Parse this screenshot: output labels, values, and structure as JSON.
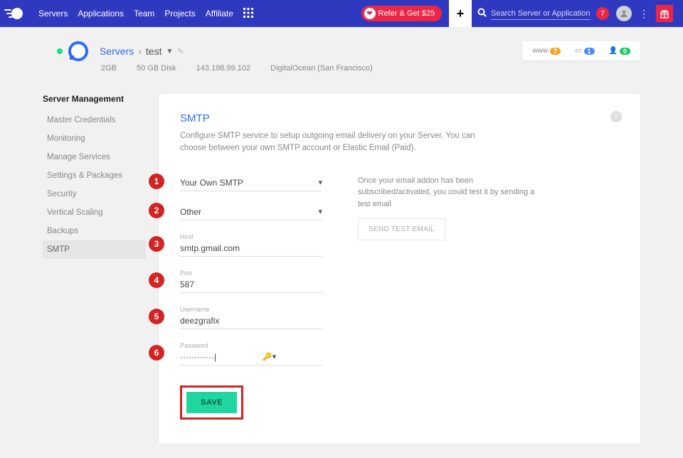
{
  "top": {
    "nav": [
      "Servers",
      "Applications",
      "Team",
      "Projects",
      "Affiliate"
    ],
    "refer": "Refer & Get $25",
    "search_ph": "Search Server or Application",
    "notif": "7"
  },
  "server": {
    "crumb_root": "Servers",
    "name": "test",
    "ram": "2GB",
    "disk": "50 GB Disk",
    "ip": "143.198.99.102",
    "provider": "DigitalOcean (San Francisco)",
    "www_label": "www",
    "www_count": "7",
    "apps_count": "1",
    "team_count": "0"
  },
  "side": {
    "heading": "Server Management",
    "items": [
      "Master Credentials",
      "Monitoring",
      "Manage Services",
      "Settings & Packages",
      "Security",
      "Vertical Scaling",
      "Backups",
      "SMTP"
    ],
    "active": "SMTP"
  },
  "panel": {
    "title": "SMTP",
    "desc": "Configure SMTP service to setup outgoing email delivery on your Server. You can choose between your own SMTP account or Elastic Email (Paid).",
    "right_note": "Once your email addon has been subscribed/activated, you could test it by sending a test email",
    "send_btn": "SEND TEST EMAIL",
    "save_btn": "SAVE",
    "fields": {
      "f1": {
        "value": "Your Own SMTP"
      },
      "f2": {
        "value": "Other"
      },
      "f3": {
        "label": "Host",
        "value": "smtp.gmail.com"
      },
      "f4": {
        "label": "Port",
        "value": "587"
      },
      "f5": {
        "label": "Username",
        "value": "deezgrafix"
      },
      "f6": {
        "label": "Password",
        "value": "············|"
      }
    },
    "steps": {
      "s1": "1",
      "s2": "2",
      "s3": "3",
      "s4": "4",
      "s5": "5",
      "s6": "6"
    }
  }
}
